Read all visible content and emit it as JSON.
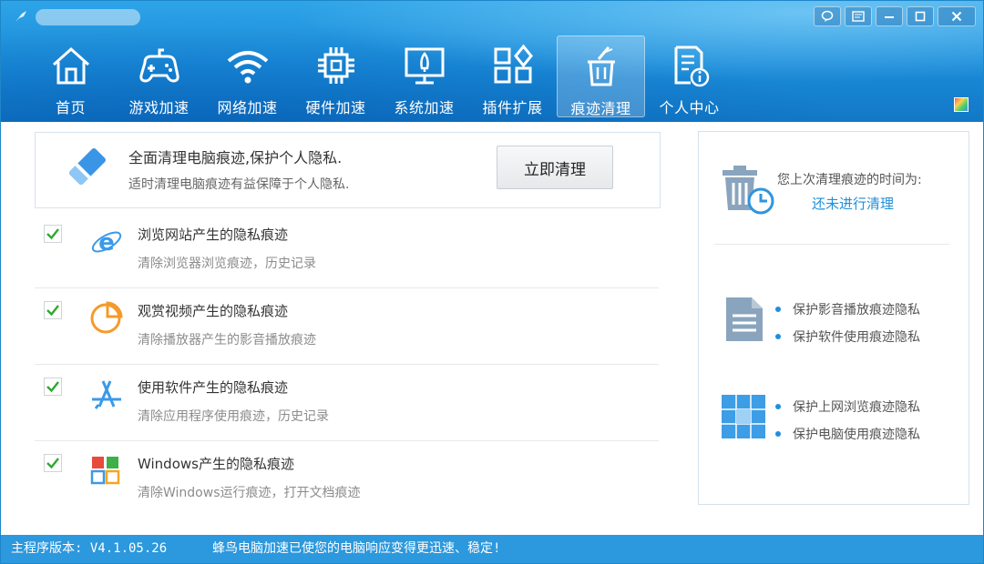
{
  "window": {
    "title_redacted": true
  },
  "nav": {
    "items": [
      {
        "label": "首页",
        "icon": "home-icon"
      },
      {
        "label": "游戏加速",
        "icon": "gamepad-icon"
      },
      {
        "label": "网络加速",
        "icon": "wifi-icon"
      },
      {
        "label": "硬件加速",
        "icon": "chip-icon"
      },
      {
        "label": "系统加速",
        "icon": "monitor-rocket-icon"
      },
      {
        "label": "插件扩展",
        "icon": "plugin-grid-icon"
      },
      {
        "label": "痕迹清理",
        "icon": "trash-broom-icon",
        "active": true
      },
      {
        "label": "个人中心",
        "icon": "document-info-icon"
      }
    ]
  },
  "banner": {
    "title": "全面清理电脑痕迹,保护个人隐私.",
    "subtitle": "适时清理电脑痕迹有益保障于个人隐私.",
    "button": "立即清理"
  },
  "items": [
    {
      "title": "浏览网站产生的隐私痕迹",
      "desc": "清除浏览器浏览痕迹，历史记录",
      "checked": true,
      "icon": "ie-browser-icon"
    },
    {
      "title": "观赏视频产生的隐私痕迹",
      "desc": "清除播放器产生的影音播放痕迹",
      "checked": true,
      "icon": "pie-chart-icon"
    },
    {
      "title": "使用软件产生的隐私痕迹",
      "desc": "清除应用程序使用痕迹，历史记录",
      "checked": true,
      "icon": "app-store-icon"
    },
    {
      "title": "Windows产生的隐私痕迹",
      "desc": "清除Windows运行痕迹，打开文档痕迹",
      "checked": true,
      "icon": "windows-logo-icon"
    }
  ],
  "right": {
    "last_label": "您上次清理痕迹的时间为:",
    "last_value": "还未进行清理",
    "group1": [
      "保护影音播放痕迹隐私",
      "保护软件使用痕迹隐私"
    ],
    "group2": [
      "保护上网浏览痕迹隐私",
      "保护电脑使用痕迹隐私"
    ]
  },
  "status": {
    "version": "主程序版本: V4.1.05.26",
    "message": "蜂鸟电脑加速已使您的电脑响应变得更迅速、稳定!"
  },
  "colors": {
    "accent": "#1f8fd8",
    "header": "#1a8ad8",
    "check": "#2fa82f"
  }
}
